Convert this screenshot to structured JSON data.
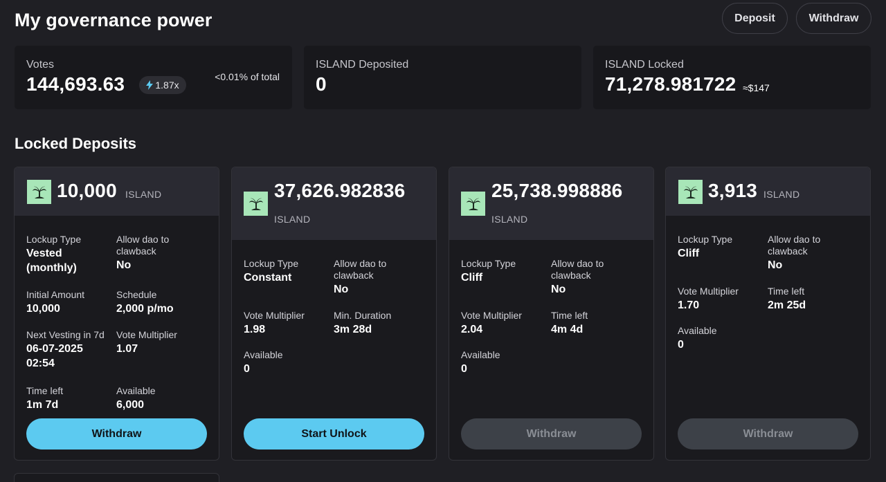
{
  "header": {
    "title": "My governance power",
    "deposit_label": "Deposit",
    "withdraw_label": "Withdraw"
  },
  "stats": {
    "votes": {
      "label": "Votes",
      "value": "144,693.63",
      "boost": "1.87x",
      "share": "<0.01% of total"
    },
    "deposited": {
      "label": "ISLAND Deposited",
      "value": "0"
    },
    "locked": {
      "label": "ISLAND Locked",
      "value": "71,278.981722",
      "usd": "≈$147"
    }
  },
  "section": {
    "title": "Locked Deposits"
  },
  "deposits": [
    {
      "amount": "10,000",
      "unit": "ISLAND",
      "icon": "palm-tree-icon",
      "fields": [
        {
          "label": "Lockup Type",
          "value": "Vested (monthly)"
        },
        {
          "label": "Allow dao to clawback",
          "value": "No"
        },
        {
          "label": "Initial Amount",
          "value": "10,000"
        },
        {
          "label": "Schedule",
          "value": "2,000 p/mo"
        },
        {
          "label": "Next Vesting in 7d",
          "value": "06-07-2025 02:54"
        },
        {
          "label": "Vote Multiplier",
          "value": "1.07"
        },
        {
          "label": "Time left",
          "value": "1m 7d"
        },
        {
          "label": "Available",
          "value": "6,000"
        }
      ],
      "action": "Withdraw"
    },
    {
      "amount": "37,626.982836",
      "unit": "ISLAND",
      "icon": "palm-tree-icon",
      "fields": [
        {
          "label": "Lockup Type",
          "value": "Constant"
        },
        {
          "label": "Allow dao to clawback",
          "value": "No"
        },
        {
          "label": "Vote Multiplier",
          "value": "1.98"
        },
        {
          "label": "Min. Duration",
          "value": "3m 28d"
        },
        {
          "label": "Available",
          "value": "0"
        }
      ],
      "action": "Start Unlock"
    },
    {
      "amount": "25,738.998886",
      "unit": "ISLAND",
      "icon": "palm-tree-icon",
      "fields": [
        {
          "label": "Lockup Type",
          "value": "Cliff"
        },
        {
          "label": "Allow dao to clawback",
          "value": "No"
        },
        {
          "label": "Vote Multiplier",
          "value": "2.04"
        },
        {
          "label": "Time left",
          "value": "4m 4d"
        },
        {
          "label": "Available",
          "value": "0"
        }
      ],
      "action": "Withdraw"
    },
    {
      "amount": "3,913",
      "unit": "ISLAND",
      "icon": "palm-tree-icon",
      "fields": [
        {
          "label": "Lockup Type",
          "value": "Cliff"
        },
        {
          "label": "Allow dao to clawback",
          "value": "No"
        },
        {
          "label": "Vote Multiplier",
          "value": "1.70"
        },
        {
          "label": "Time left",
          "value": "2m 25d"
        },
        {
          "label": "Available",
          "value": "0"
        }
      ],
      "action": "Withdraw"
    }
  ],
  "colors": {
    "background": "#1f1f24",
    "card": "#18181c",
    "accent_button": "#5ccaf0",
    "disabled_button": "#3d4148",
    "token_icon_bg": "#a8e6b8"
  }
}
